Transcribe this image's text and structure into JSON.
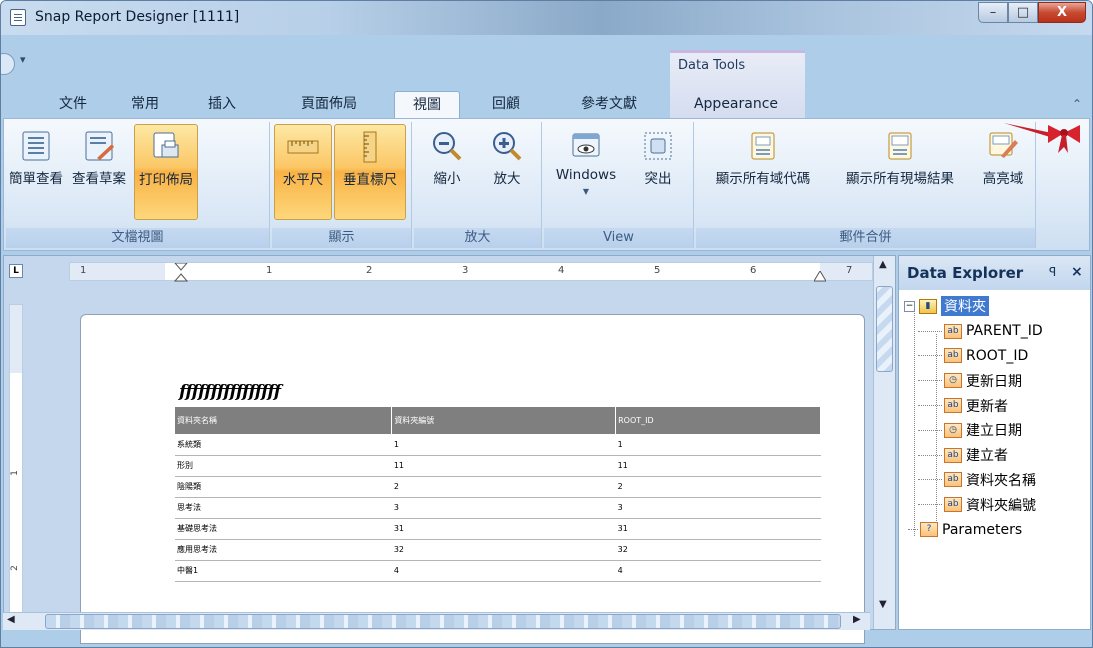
{
  "window": {
    "title": "Snap Report Designer [1111]",
    "minimize": "–",
    "maximize": "□",
    "close": "X"
  },
  "quick_access": {
    "dropdown": "▾"
  },
  "contextual_group": {
    "label": "Data Tools"
  },
  "tabs": [
    {
      "label": "文件"
    },
    {
      "label": "常用"
    },
    {
      "label": "插入"
    },
    {
      "label": "頁面佈局"
    },
    {
      "label": "視圖",
      "active": true
    },
    {
      "label": "回顧"
    },
    {
      "label": "參考文獻"
    },
    {
      "label": "Appearance"
    }
  ],
  "ribbon": {
    "collapse": "⌃",
    "groups": [
      {
        "label": "文檔視圖",
        "buttons": [
          {
            "label": "簡單查看",
            "icon": "simple-view-icon"
          },
          {
            "label": "查看草案",
            "icon": "draft-view-icon"
          },
          {
            "label": "打印佈局",
            "icon": "print-layout-icon",
            "active": true
          }
        ]
      },
      {
        "label": "顯示",
        "buttons": [
          {
            "label": "水平尺",
            "icon": "horizontal-ruler-icon",
            "active": true
          },
          {
            "label": "垂直標尺",
            "icon": "vertical-ruler-icon",
            "active": true
          }
        ]
      },
      {
        "label": "放大",
        "buttons": [
          {
            "label": "縮小",
            "icon": "zoom-out-icon"
          },
          {
            "label": "放大",
            "icon": "zoom-in-icon"
          }
        ]
      },
      {
        "label": "View",
        "buttons": [
          {
            "label": "Windows",
            "icon": "windows-icon",
            "dropdown": "▼"
          },
          {
            "label": "突出",
            "icon": "highlight-icon"
          }
        ]
      },
      {
        "label": "郵件合併",
        "buttons": [
          {
            "label": "顯示所有域代碼",
            "icon": "field-codes-icon"
          },
          {
            "label": "顯示所有現場結果",
            "icon": "field-results-icon"
          },
          {
            "label": "高亮域",
            "icon": "highlight-fields-icon"
          }
        ]
      }
    ]
  },
  "ruler": {
    "corner": "L",
    "numbers": [
      "1",
      "1",
      "2",
      "3",
      "4",
      "5",
      "6",
      "7"
    ],
    "vertical_numbers": [
      "1",
      "2"
    ]
  },
  "document": {
    "title": "ffffffffffffffff",
    "table": {
      "headers": [
        "資料夾名稱",
        "資料夾編號",
        "ROOT_ID"
      ],
      "rows": [
        [
          "系統類",
          "1",
          "1"
        ],
        [
          "形別",
          "11",
          "11"
        ],
        [
          "陰陽類",
          "2",
          "2"
        ],
        [
          "思考法",
          "3",
          "3"
        ],
        [
          "基礎思考法",
          "31",
          "31"
        ],
        [
          "應用思考法",
          "32",
          "32"
        ],
        [
          "中醫1",
          "4",
          "4"
        ]
      ]
    }
  },
  "explorer": {
    "title": "Data Explorer",
    "pin": "ꟼ",
    "close": "×",
    "root": {
      "label": "資料夾",
      "expander": "−"
    },
    "fields": [
      {
        "label": "PARENT_ID",
        "type": "ab"
      },
      {
        "label": "ROOT_ID",
        "type": "ab"
      },
      {
        "label": "更新日期",
        "type": "clock"
      },
      {
        "label": "更新者",
        "type": "ab"
      },
      {
        "label": "建立日期",
        "type": "clock"
      },
      {
        "label": "建立者",
        "type": "ab"
      },
      {
        "label": "資料夾名稱",
        "type": "ab"
      },
      {
        "label": "資料夾編號",
        "type": "ab"
      }
    ],
    "parameters": {
      "label": "Parameters",
      "icon_text": "?"
    }
  },
  "icon_text": {
    "ab": "ab",
    "clock": "◷",
    "folder": "▮"
  }
}
